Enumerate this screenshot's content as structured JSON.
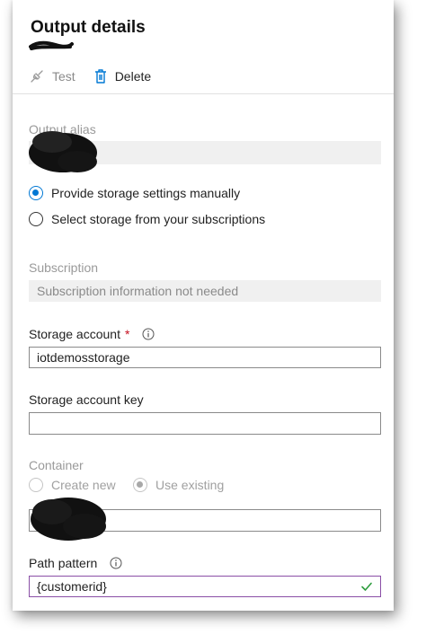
{
  "header": {
    "title": "Output details"
  },
  "toolbar": {
    "test_label": "Test",
    "test_icon": "plug-icon",
    "delete_label": "Delete",
    "delete_icon": "trash-icon"
  },
  "output_alias": {
    "label": "Output alias",
    "value": ""
  },
  "storage_mode": {
    "options": [
      {
        "label": "Provide storage settings manually",
        "selected": true
      },
      {
        "label": "Select storage from your subscriptions",
        "selected": false
      }
    ]
  },
  "subscription": {
    "label": "Subscription",
    "placeholder": "Subscription information not needed"
  },
  "storage_account": {
    "label": "Storage account",
    "required_marker": "*",
    "value": "iotdemosstorage"
  },
  "storage_account_key": {
    "label": "Storage account key",
    "value": ""
  },
  "container": {
    "label": "Container",
    "options": [
      {
        "label": "Create new",
        "selected": false
      },
      {
        "label": "Use existing",
        "selected": true
      }
    ],
    "value": ""
  },
  "path_pattern": {
    "label": "Path pattern",
    "value": "{customerid}",
    "valid": true
  },
  "colors": {
    "accent": "#0078d4",
    "valid_border": "#8a4fa6",
    "check": "#2e9d3e",
    "required": "#c50f1f"
  }
}
